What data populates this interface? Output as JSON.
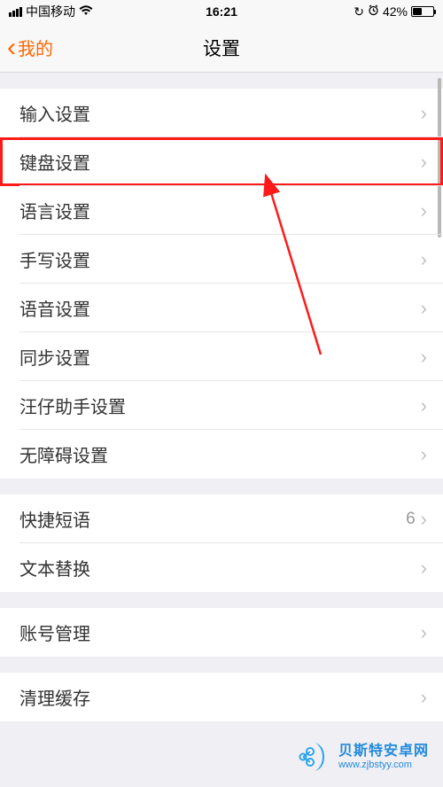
{
  "status": {
    "carrier": "中国移动",
    "time": "16:21",
    "battery_pct": "42%"
  },
  "nav": {
    "back_label": "我的",
    "title": "设置"
  },
  "groups": [
    {
      "rows": [
        {
          "label": "输入设置",
          "highlighted": false
        },
        {
          "label": "键盘设置",
          "highlighted": true
        },
        {
          "label": "语言设置",
          "highlighted": false
        },
        {
          "label": "手写设置",
          "highlighted": false
        },
        {
          "label": "语音设置",
          "highlighted": false
        },
        {
          "label": "同步设置",
          "highlighted": false
        },
        {
          "label": "汪仔助手设置",
          "highlighted": false
        },
        {
          "label": "无障碍设置",
          "highlighted": false
        }
      ]
    },
    {
      "rows": [
        {
          "label": "快捷短语",
          "value": "6",
          "highlighted": false
        },
        {
          "label": "文本替换",
          "highlighted": false
        }
      ]
    },
    {
      "rows": [
        {
          "label": "账号管理",
          "highlighted": false
        }
      ]
    },
    {
      "rows": [
        {
          "label": "清理缓存",
          "highlighted": false
        }
      ]
    }
  ],
  "watermark": {
    "line1": "贝斯特安卓网",
    "line2": "www.zjbstyy.com"
  }
}
